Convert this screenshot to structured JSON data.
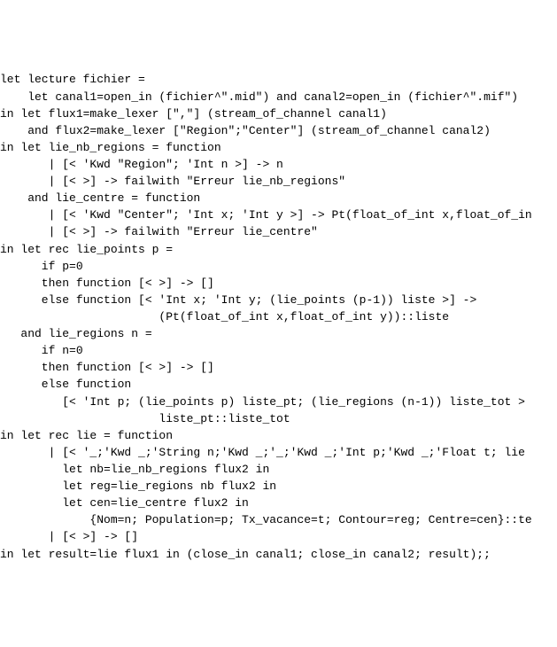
{
  "code_lines": [
    "let lecture fichier =",
    "    let canal1=open_in (fichier^\".mid\") and canal2=open_in (fichier^\".mif\")",
    "in let flux1=make_lexer [\",\"] (stream_of_channel canal1)",
    "    and flux2=make_lexer [\"Region\";\"Center\"] (stream_of_channel canal2)",
    "",
    "in let lie_nb_regions = function",
    "       | [< 'Kwd \"Region\"; 'Int n >] -> n",
    "       | [< >] -> failwith \"Erreur lie_nb_regions\"",
    "",
    "    and lie_centre = function",
    "       | [< 'Kwd \"Center\"; 'Int x; 'Int y >] -> Pt(float_of_int x,float_of_in",
    "       | [< >] -> failwith \"Erreur lie_centre\"",
    "",
    "in let rec lie_points p =",
    "      if p=0",
    "      then function [< >] -> []",
    "      else function [< 'Int x; 'Int y; (lie_points (p-1)) liste >] ->",
    "                       (Pt(float_of_int x,float_of_int y))::liste",
    "",
    "   and lie_regions n =",
    "      if n=0",
    "      then function [< >] -> []",
    "      else function",
    "         [< 'Int p; (lie_points p) liste_pt; (lie_regions (n-1)) liste_tot >",
    "                       liste_pt::liste_tot",
    "",
    "in let rec lie = function",
    "       | [< '_;'Kwd _;'String n;'Kwd _;'_;'Kwd _;'Int p;'Kwd _;'Float t; lie ",
    "         let nb=lie_nb_regions flux2 in",
    "         let reg=lie_regions nb flux2 in",
    "         let cen=lie_centre flux2 in",
    "             {Nom=n; Population=p; Tx_vacance=t; Contour=reg; Centre=cen}::te",
    "       | [< >] -> []",
    "",
    "in let result=lie flux1 in (close_in canal1; close_in canal2; result);;"
  ]
}
